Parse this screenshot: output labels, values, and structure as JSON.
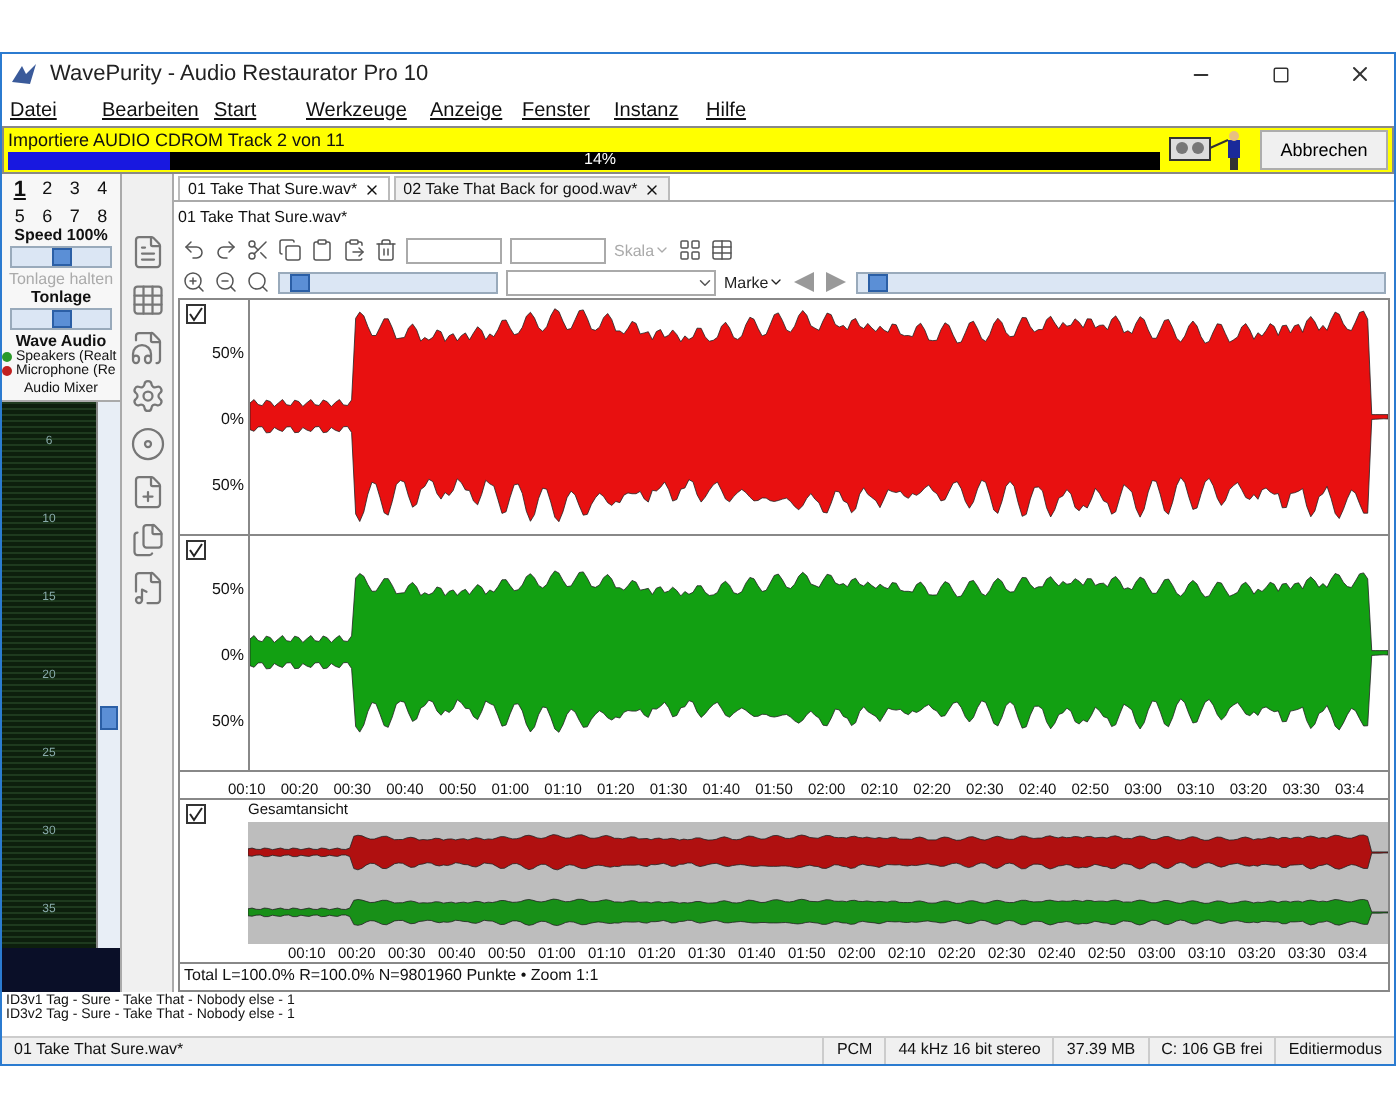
{
  "window": {
    "title": "WavePurity - Audio Restaurator Pro 10"
  },
  "menu": [
    "Datei",
    "Bearbeiten",
    "Start",
    "Werkzeuge",
    "Anzeige",
    "Fenster",
    "Instanz",
    "Hilfe"
  ],
  "progress": {
    "message": "Importiere AUDIO CDROM Track 2 von 11",
    "level": 0.14,
    "reading": "14%",
    "cancel": "Abbrechen"
  },
  "presets": [
    {
      "label": "1",
      "selected": true
    },
    {
      "label": "2",
      "selected": false
    },
    {
      "label": "3",
      "selected": false
    },
    {
      "label": "4",
      "selected": false
    },
    {
      "label": "5",
      "selected": false
    },
    {
      "label": "6",
      "selected": false
    },
    {
      "label": "7",
      "selected": false
    },
    {
      "label": "8",
      "selected": false
    }
  ],
  "speed": {
    "label": "Speed 100%",
    "level": 0.5
  },
  "pitch_hold": {
    "label": "Tonlage halten",
    "disabled": true
  },
  "pitch": {
    "label": "Tonlage",
    "level": 0.5
  },
  "devices": {
    "title": "Wave Audio",
    "items": [
      {
        "label": "Speakers (Realt",
        "color": "#2a9a2a"
      },
      {
        "label": "Microphone (Re",
        "color": "#c02020"
      }
    ],
    "mixer": "Audio Mixer"
  },
  "meter": {
    "labels": [
      "6",
      "10",
      "15",
      "20",
      "25",
      "30",
      "35"
    ],
    "level": 0.42
  },
  "tabs": [
    {
      "label": "01 Take That Sure.wav*",
      "selected": true
    },
    {
      "label": "02 Take That Back for good.wav*",
      "selected": false
    }
  ],
  "file_label": "01 Take That Sure.wav*",
  "toolbar": {
    "scale": "Skala",
    "marker": "Marke",
    "zoom_slider": {
      "level": 0.05
    },
    "position_slider": {
      "level": 0.02
    }
  },
  "channels": [
    {
      "color": "#e81010",
      "checked": true,
      "ticks": [
        "50%",
        "0%",
        "50%"
      ]
    },
    {
      "color": "#12a012",
      "checked": true,
      "ticks": [
        "50%",
        "0%",
        "50%"
      ]
    }
  ],
  "time_axis": [
    "00:10",
    "00:20",
    "00:30",
    "00:40",
    "00:50",
    "01:00",
    "01:10",
    "01:20",
    "01:30",
    "01:40",
    "01:50",
    "02:00",
    "02:10",
    "02:20",
    "02:30",
    "02:40",
    "02:50",
    "03:00",
    "03:10",
    "03:20",
    "03:30",
    "03:4"
  ],
  "overview": {
    "title": "Gesamtansicht",
    "checked": true,
    "time_axis": [
      "00:10",
      "00:20",
      "00:30",
      "00:40",
      "00:50",
      "01:00",
      "01:10",
      "01:20",
      "01:30",
      "01:40",
      "01:50",
      "02:00",
      "02:10",
      "02:20",
      "02:30",
      "02:40",
      "02:50",
      "03:00",
      "03:10",
      "03:20",
      "03:30",
      "03:4"
    ]
  },
  "total": "Total L=100.0% R=100.0% N=9801960 Punkte • Zoom 1:1",
  "tags": [
    "ID3v1 Tag - Sure - Take That - Nobody else - 1",
    "ID3v2 Tag - Sure - Take That - Nobody else - 1"
  ],
  "status": [
    "01 Take That Sure.wav*",
    "PCM",
    "44 kHz 16 bit stereo",
    "37.39 MB",
    "C: 106 GB frei",
    "Editiermodus"
  ]
}
